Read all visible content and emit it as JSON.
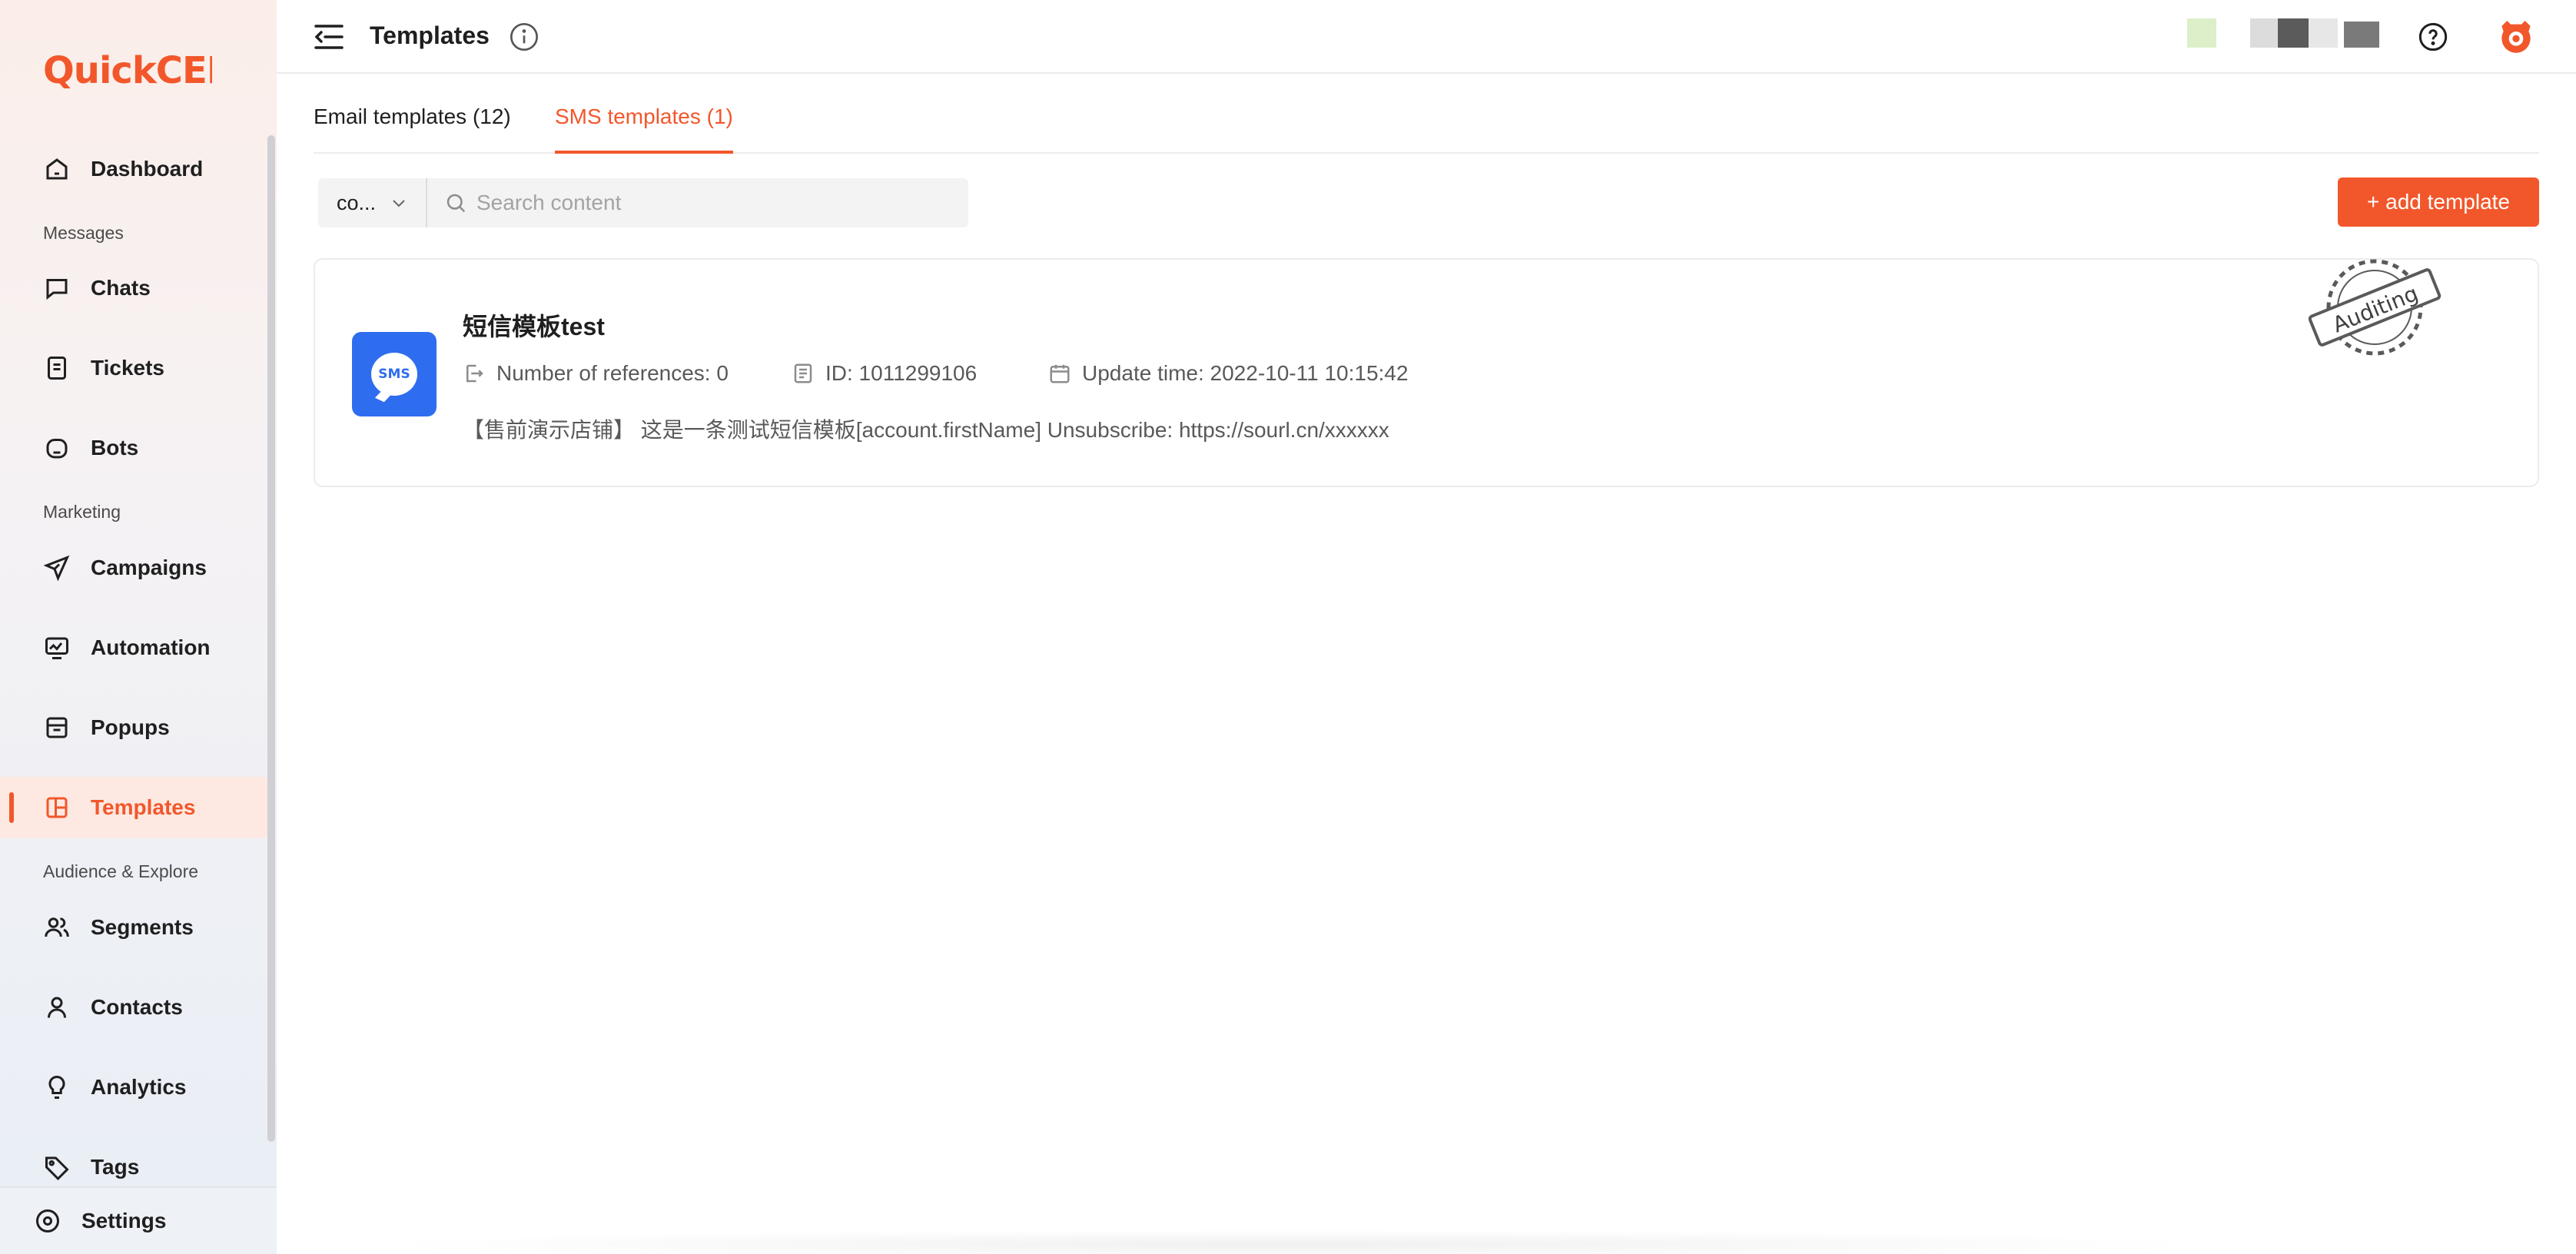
{
  "app": {
    "brand": "QuickCEP",
    "brand_color": "#f2572b"
  },
  "sidebar": {
    "items": [
      {
        "label": "Dashboard",
        "icon": "home-icon"
      },
      {
        "label": "Chats",
        "icon": "chat-icon"
      },
      {
        "label": "Tickets",
        "icon": "ticket-icon"
      },
      {
        "label": "Bots",
        "icon": "bot-icon"
      },
      {
        "label": "Campaigns",
        "icon": "send-icon"
      },
      {
        "label": "Automation",
        "icon": "automation-icon"
      },
      {
        "label": "Popups",
        "icon": "popup-icon"
      },
      {
        "label": "Templates",
        "icon": "template-icon",
        "active": true
      },
      {
        "label": "Segments",
        "icon": "users-icon"
      },
      {
        "label": "Contacts",
        "icon": "user-icon"
      },
      {
        "label": "Analytics",
        "icon": "bulb-icon"
      },
      {
        "label": "Tags",
        "icon": "tag-icon"
      }
    ],
    "sections": {
      "messages": "Messages",
      "marketing": "Marketing",
      "audience": "Audience & Explore"
    },
    "settings_label": "Settings"
  },
  "header": {
    "title": "Templates"
  },
  "tabs": [
    {
      "label": "Email templates (12)",
      "active": false
    },
    {
      "label": "SMS templates (1)",
      "active": true
    }
  ],
  "filter": {
    "select_value": "co...",
    "search_placeholder": "Search content"
  },
  "add_button_label": "+ add template",
  "templates": [
    {
      "name": "短信模板test",
      "badge_label": "SMS",
      "references": "Number of references: 0",
      "id": "ID: 1011299106",
      "update_time": "Update time: 2022-10-11 10:15:42",
      "content": "【售前演示店铺】 这是一条测试短信模板[account.firstName] Unsubscribe: https://sourl.cn/xxxxxx",
      "status": "Auditing"
    }
  ]
}
